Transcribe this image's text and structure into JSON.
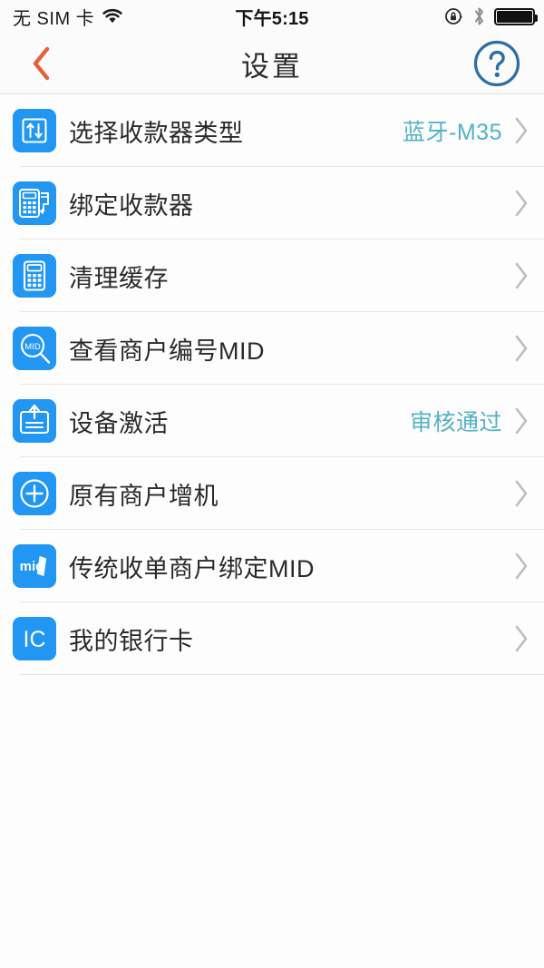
{
  "status_bar": {
    "carrier": "无 SIM 卡",
    "time": "下午5:15",
    "icons": [
      "wifi-icon",
      "rotation-lock-icon",
      "bluetooth-icon",
      "battery-icon"
    ]
  },
  "nav": {
    "back_label": "‹",
    "title": "设置",
    "help_label": "?"
  },
  "colors": {
    "icon_blue": "#2196f3",
    "value_teal": "#54b2c6",
    "back_orange": "#e2613a",
    "help_blue": "#2e6da4",
    "separator": "#e6e6e6",
    "page_bg": "#fcfcfc"
  },
  "list": {
    "items": [
      {
        "label": "选择收款器类型",
        "value": "蓝牙-M35",
        "icon": "transfer-arrows-icon"
      },
      {
        "label": "绑定收款器",
        "value": "",
        "icon": "pos-terminal-icon"
      },
      {
        "label": "清理缓存",
        "value": "",
        "icon": "calculator-icon"
      },
      {
        "label": "查看商户编号MID",
        "value": "",
        "icon": "mid-search-icon"
      },
      {
        "label": "设备激活",
        "value": "审核通过",
        "icon": "device-activate-icon"
      },
      {
        "label": "原有商户增机",
        "value": "",
        "icon": "plus-circle-icon"
      },
      {
        "label": "传统收单商户绑定MID",
        "value": "",
        "icon": "mid-card-icon"
      },
      {
        "label": "我的银行卡",
        "value": "",
        "icon": "ic-card-icon"
      }
    ]
  }
}
